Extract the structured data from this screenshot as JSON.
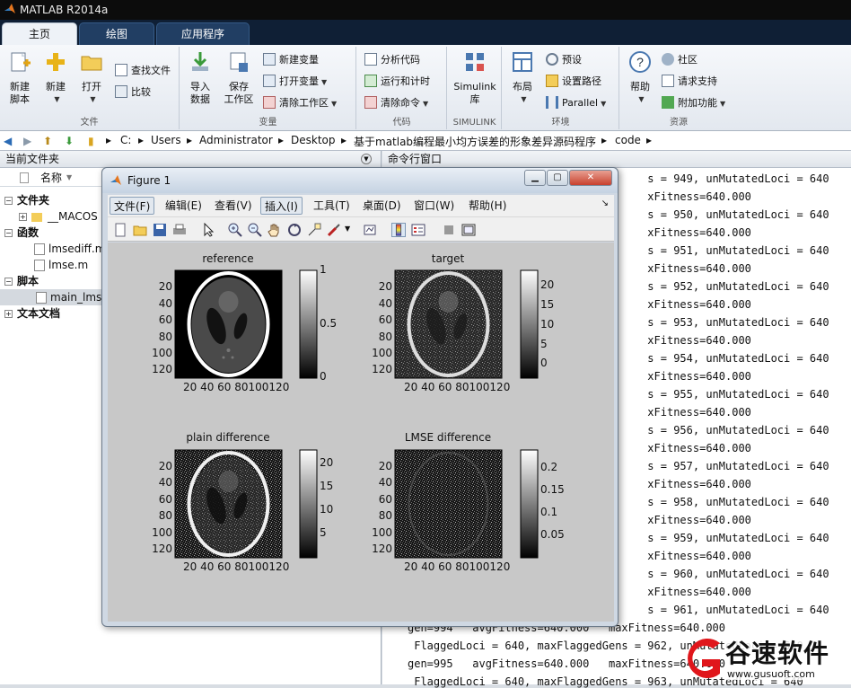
{
  "app": {
    "title": "MATLAB R2014a",
    "tabs": [
      "主页",
      "绘图",
      "应用程序"
    ]
  },
  "ribbon": {
    "file_group": {
      "label": "文件",
      "new_script": [
        "新建",
        "脚本"
      ],
      "new": "新建",
      "open": "打开",
      "find_files": "查找文件",
      "compare": "比较"
    },
    "variable_group": {
      "label": "变量",
      "import": [
        "导入",
        "数据"
      ],
      "save_ws": [
        "保存",
        "工作区"
      ],
      "new_var": "新建变量",
      "open_var": "打开变量",
      "clear_ws": "清除工作区"
    },
    "code_group": {
      "label": "代码",
      "analyze": "分析代码",
      "run_time": "运行和计时",
      "clear_cmd": "清除命令"
    },
    "simulink_group": {
      "label": "SIMULINK",
      "simulink": [
        "Simulink",
        "库"
      ]
    },
    "env_group": {
      "label": "环境",
      "layout": "布局",
      "prefs": "预设",
      "set_path": "设置路径",
      "parallel": "Parallel"
    },
    "resources_group": {
      "label": "资源",
      "help": "帮助",
      "community": "社区",
      "support": "请求支持",
      "addons": "附加功能"
    }
  },
  "path": [
    "C:",
    "Users",
    "Administrator",
    "Desktop",
    "基于matlab编程最小均方误差的形象差异源码程序",
    "code"
  ],
  "left_panel": {
    "title": "当前文件夹",
    "col_name": "名称",
    "groups": {
      "folder": "文件夹",
      "folder_item": "__MACOS",
      "funcs": "函数",
      "func1": "lmsediff.m",
      "func2": "lmse.m",
      "scripts": "脚本",
      "script1": "main_lmse",
      "docs": "文本文档"
    }
  },
  "right_panel": {
    "title": "命令行窗口",
    "lines": [
      "                                     s = 949, unMutatedLoci = 640",
      "                                     xFitness=640.000",
      "                                     s = 950, unMutatedLoci = 640",
      "                                     xFitness=640.000",
      "                                     s = 951, unMutatedLoci = 640",
      "                                     xFitness=640.000",
      "                                     s = 952, unMutatedLoci = 640",
      "                                     xFitness=640.000",
      "                                     s = 953, unMutatedLoci = 640",
      "                                     xFitness=640.000",
      "                                     s = 954, unMutatedLoci = 640",
      "                                     xFitness=640.000",
      "                                     s = 955, unMutatedLoci = 640",
      "                                     xFitness=640.000",
      "                                     s = 956, unMutatedLoci = 640",
      "                                     xFitness=640.000",
      "                                     s = 957, unMutatedLoci = 640",
      "                                     xFitness=640.000",
      "                                     s = 958, unMutatedLoci = 640",
      "                                     xFitness=640.000",
      "                                     s = 959, unMutatedLoci = 640",
      "                                     xFitness=640.000",
      "                                     s = 960, unMutatedLoci = 640",
      "                                     xFitness=640.000",
      "                                     s = 961, unMutatedLoci = 640",
      "gen=994   avgFitness=640.000   maxFitness=640.000",
      " FlaggedLoci = 640, maxFlaggedGens = 962, unMutatedLoci = 640",
      "gen=995   avgFitness=640.000   maxFitness=640.000",
      " FlaggedLoci = 640, maxFlaggedGens = 963, unMutatedLoci = 640"
    ]
  },
  "figure": {
    "title": "Figure 1",
    "menu": [
      "文件(F)",
      "编辑(E)",
      "查看(V)",
      "插入(I)",
      "工具(T)",
      "桌面(D)",
      "窗口(W)",
      "帮助(H)"
    ],
    "plots": [
      {
        "title": "reference",
        "yticks": [
          "20",
          "40",
          "60",
          "80",
          "100",
          "120"
        ],
        "xticks": "20 40 60 80100120",
        "cbar": [
          "1",
          "0.5",
          "0"
        ]
      },
      {
        "title": "target",
        "yticks": [
          "20",
          "40",
          "60",
          "80",
          "100",
          "120"
        ],
        "xticks": "20 40 60 80100120",
        "cbar": [
          "20",
          "15",
          "10",
          "5",
          "0"
        ]
      },
      {
        "title": "plain difference",
        "yticks": [
          "20",
          "40",
          "60",
          "80",
          "100",
          "120"
        ],
        "xticks": "20 40 60 80100120",
        "cbar": [
          "20",
          "15",
          "10",
          "5"
        ]
      },
      {
        "title": "LMSE difference",
        "yticks": [
          "20",
          "40",
          "60",
          "80",
          "100",
          "120"
        ],
        "xticks": "20 40 60 80100120",
        "cbar": [
          "0.2",
          "0.15",
          "0.1",
          "0.05"
        ]
      }
    ]
  },
  "watermark": {
    "brand": "谷速软件",
    "url": "www.gusuoft.com"
  },
  "colors": {
    "title_bg": "#0c0c0c",
    "tab_bg": "#0f1f35",
    "watermark_red": "#e0161b"
  }
}
